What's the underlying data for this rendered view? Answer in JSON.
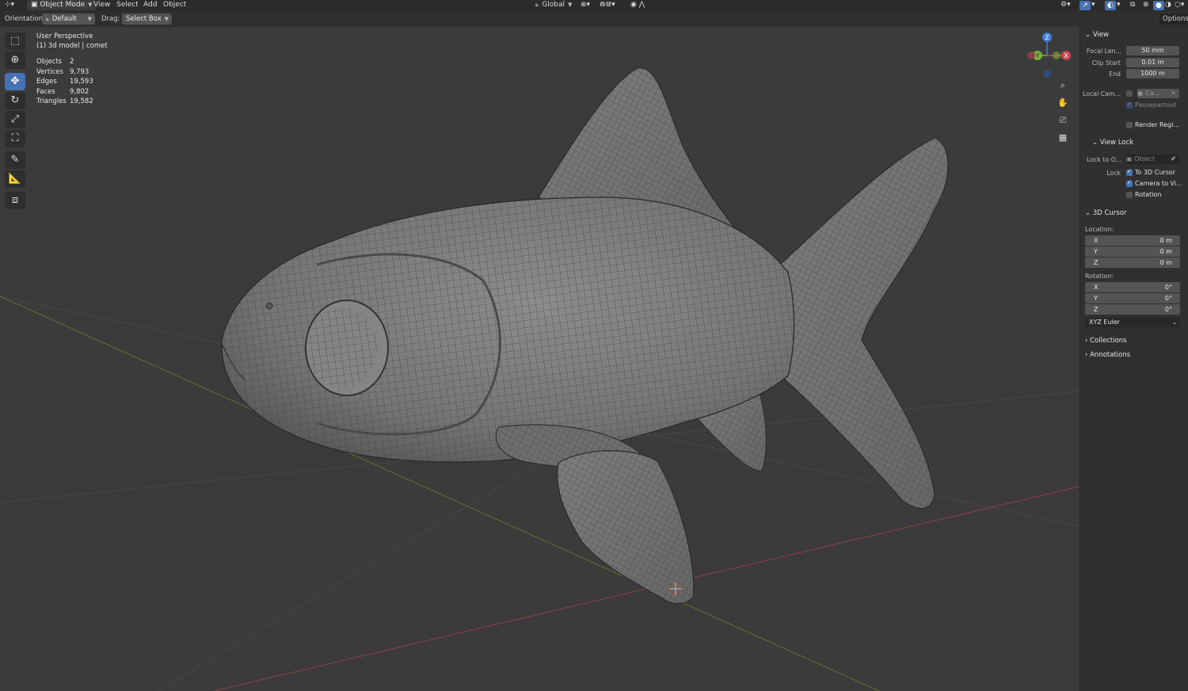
{
  "header": {
    "mode": "Object Mode",
    "menus": [
      "View",
      "Select",
      "Add",
      "Object"
    ],
    "orientation_label": "Orientation:",
    "orientation_value": "Default",
    "drag_label": "Drag:",
    "drag_value": "Select Box",
    "transform_orientation": "Global",
    "options_label": "Options"
  },
  "viewport": {
    "view_name": "User Perspective",
    "object_name": "(1) 3d model | comet",
    "stats": [
      {
        "label": "Objects",
        "value": "2"
      },
      {
        "label": "Vertices",
        "value": "9,793"
      },
      {
        "label": "Edges",
        "value": "19,593"
      },
      {
        "label": "Faces",
        "value": "9,802"
      },
      {
        "label": "Triangles",
        "value": "19,582"
      }
    ],
    "gizmo": {
      "z": "Z",
      "y": "Y",
      "x": "X"
    }
  },
  "sidebar": {
    "view": {
      "title": "View",
      "focal_label": "Focal Len...",
      "focal_value": "50 mm",
      "clip_start_label": "Clip Start",
      "clip_start_value": "0.01 m",
      "end_label": "End",
      "end_value": "1000 m",
      "local_cam_label": "Local Cam...",
      "local_cam_value": "Ca...",
      "passepartout_label": "Passepartout",
      "render_region_label": "Render Regi..."
    },
    "view_lock": {
      "title": "View Lock",
      "lock_to_label": "Lock to O...",
      "lock_to_placeholder": "Object",
      "lock_label": "Lock",
      "to_cursor_label": "To 3D Cursor",
      "camera_label": "Camera to Vi...",
      "rotation_label": "Rotation"
    },
    "cursor": {
      "title": "3D Cursor",
      "location_label": "Location:",
      "location": [
        {
          "axis": "X",
          "value": "0 m"
        },
        {
          "axis": "Y",
          "value": "0 m"
        },
        {
          "axis": "Z",
          "value": "0 m"
        }
      ],
      "rotation_label": "Rotation:",
      "rotation": [
        {
          "axis": "X",
          "value": "0°"
        },
        {
          "axis": "Y",
          "value": "0°"
        },
        {
          "axis": "Z",
          "value": "0°"
        }
      ],
      "rotation_mode": "XYZ Euler"
    },
    "collections_title": "Collections",
    "annotations_title": "Annotations"
  },
  "colors": {
    "accent": "#4772b3",
    "x_axis": "#c8474f",
    "y_axis": "#7fae3a",
    "z_axis": "#3d7fd9"
  }
}
